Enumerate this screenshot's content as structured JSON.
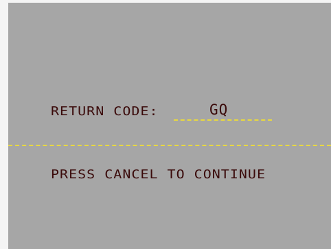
{
  "screen": {
    "return_code_label": "RETURN CODE:",
    "return_code_value": "GQ",
    "instruction": "PRESS CANCEL TO CONTINUE"
  },
  "colors": {
    "background": "#a6a6a6",
    "text": "#3a0a0a",
    "field_underline": "#e8d840"
  }
}
